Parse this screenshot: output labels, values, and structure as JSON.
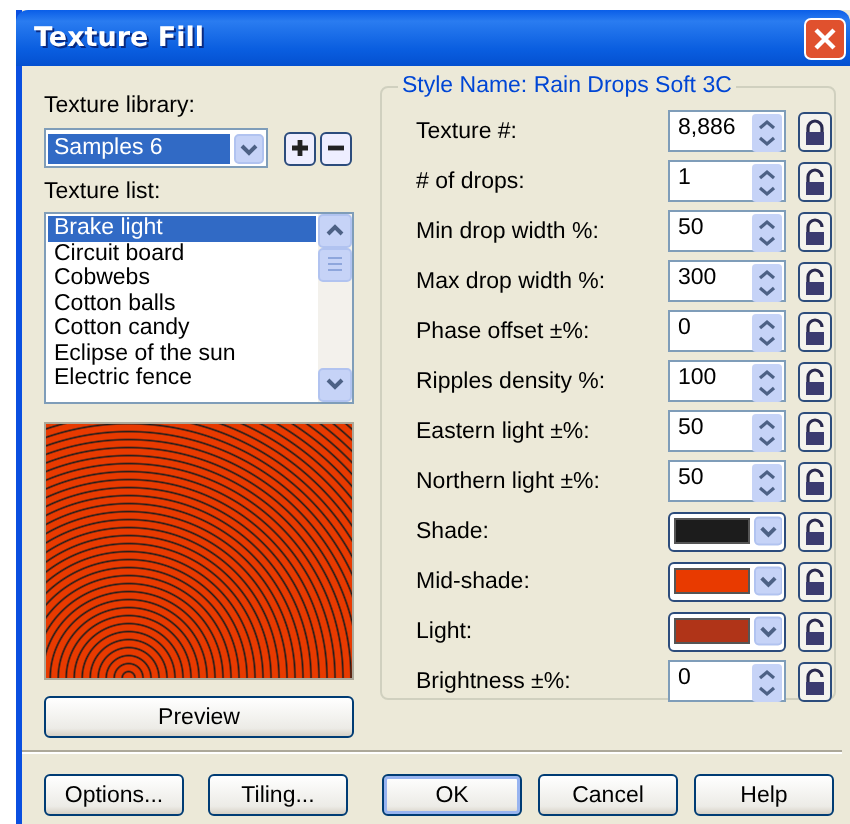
{
  "window": {
    "title": "Texture Fill"
  },
  "texture_library": {
    "label": "Texture library:",
    "value": "Samples 6"
  },
  "texture_list": {
    "label": "Texture list:",
    "items": [
      {
        "label": "Brake light",
        "selected": true
      },
      {
        "label": "Circuit board",
        "selected": false
      },
      {
        "label": "Cobwebs",
        "selected": false
      },
      {
        "label": "Cotton balls",
        "selected": false
      },
      {
        "label": "Cotton candy",
        "selected": false
      },
      {
        "label": "Eclipse of the sun",
        "selected": false
      },
      {
        "label": "Electric fence",
        "selected": false
      }
    ]
  },
  "preview_button": "Preview",
  "style_name": "Style Name: Rain Drops Soft 3C",
  "params": [
    {
      "kind": "spin",
      "label": "Texture #:",
      "value": "8,886",
      "locked": true
    },
    {
      "kind": "spin",
      "label": "# of drops:",
      "value": "1",
      "locked": false
    },
    {
      "kind": "spin",
      "label": "Min drop width %:",
      "value": "50",
      "locked": false
    },
    {
      "kind": "spin",
      "label": "Max drop width %:",
      "value": "300",
      "locked": false
    },
    {
      "kind": "spin",
      "label": "Phase offset ±%:",
      "value": "0",
      "locked": false
    },
    {
      "kind": "spin",
      "label": "Ripples density %:",
      "value": "100",
      "locked": false
    },
    {
      "kind": "spin",
      "label": "Eastern light ±%:",
      "value": "50",
      "locked": false
    },
    {
      "kind": "spin",
      "label": "Northern light ±%:",
      "value": "50",
      "locked": false
    },
    {
      "kind": "color",
      "label": "Shade:",
      "color": "#1c1c1c",
      "locked": false
    },
    {
      "kind": "color",
      "label": "Mid-shade:",
      "color": "#e83a00",
      "locked": false
    },
    {
      "kind": "color",
      "label": "Light:",
      "color": "#b03418",
      "locked": false
    },
    {
      "kind": "spin",
      "label": "Brightness ±%:",
      "value": "0",
      "locked": false
    }
  ],
  "buttons": [
    {
      "label": "Options...",
      "default": false
    },
    {
      "label": "Tiling...",
      "default": false
    },
    {
      "label": "OK",
      "default": true
    },
    {
      "label": "Cancel",
      "default": false
    },
    {
      "label": "Help",
      "default": false
    }
  ]
}
